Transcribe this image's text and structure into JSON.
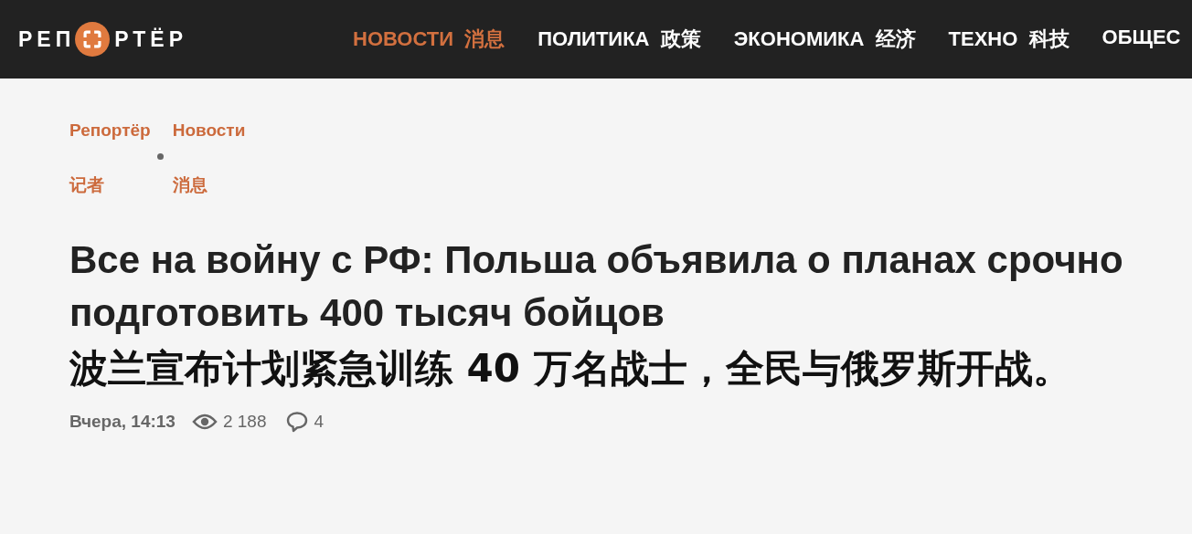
{
  "header": {
    "logo": {
      "left": "РЕП",
      "right": "РТЁР"
    },
    "nav": [
      {
        "label": "НОВОСТИ",
        "translation": "消息",
        "selected": true
      },
      {
        "label": "ПОЛИТИКА",
        "translation": "政策",
        "selected": false
      },
      {
        "label": "ЭКОНОМИКА",
        "translation": "经济",
        "selected": false
      },
      {
        "label": "ТЕХНО",
        "translation": "科技",
        "selected": false
      },
      {
        "label": "ОБЩЕС",
        "selected": false
      }
    ]
  },
  "breadcrumbs": [
    {
      "label": "Репортёр",
      "translation": "记者"
    },
    {
      "label": "Новости",
      "translation": "消息"
    }
  ],
  "article": {
    "title": "Все на войну с РФ: Польша объявила о планах срочно подготовить 400 тысяч бойцов",
    "title_translation": "波兰宣布计划紧急训练 40 万名战士，全民与俄罗斯开战。",
    "date": "Вчера, 14:13",
    "views": "2 188",
    "comments": "4"
  }
}
